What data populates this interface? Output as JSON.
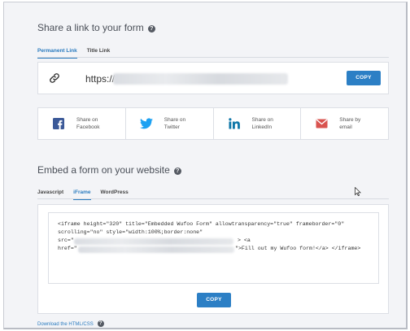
{
  "share": {
    "title": "Share a link to your form",
    "tabs": [
      {
        "label": "Permanent Link",
        "active": true
      },
      {
        "label": "Title Link",
        "active": false
      }
    ],
    "link_prefix": "https://",
    "copy_label": "COPY",
    "options": [
      {
        "label_line1": "Share on",
        "label_line2": "Facebook",
        "icon": "facebook-icon"
      },
      {
        "label_line1": "Share on",
        "label_line2": "Twitter",
        "icon": "twitter-icon"
      },
      {
        "label_line1": "Share on",
        "label_line2": "LinkedIn",
        "icon": "linkedin-icon"
      },
      {
        "label_line1": "Share by",
        "label_line2": "email",
        "icon": "email-icon"
      }
    ]
  },
  "embed": {
    "title": "Embed a form on your website",
    "tabs": [
      {
        "label": "Javascript",
        "active": false
      },
      {
        "label": "iFrame",
        "active": true
      },
      {
        "label": "WordPress",
        "active": false
      }
    ],
    "code_line1": "<iframe height=\"320\" title=\"Embedded Wufoo Form\" allowtransparency=\"true\" frameborder=\"0\"",
    "code_line2": "scrolling=\"no\" style=\"width:100%;border:none\"",
    "code_line3_start": "src=\"",
    "code_line3_end": "> <a",
    "code_line4_start": "href=\"",
    "code_line4_end": "\">Fill out my Wufoo form!</a> </iframe>",
    "copy_label": "COPY"
  },
  "footer": {
    "download_label": "Download the HTML/CSS"
  },
  "colors": {
    "accent": "#2c7fc5",
    "facebook": "#3b5998",
    "twitter": "#1da1f2",
    "linkedin": "#0e76a8",
    "email": "#d9534f"
  }
}
